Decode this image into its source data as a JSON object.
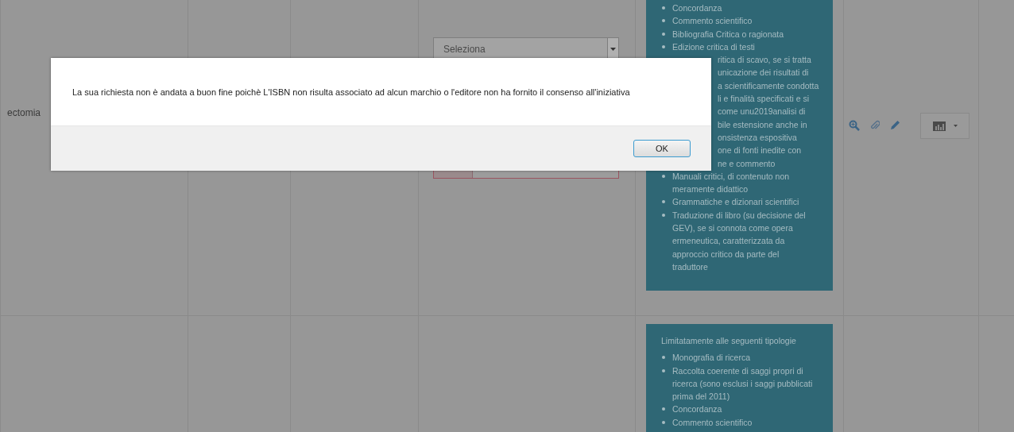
{
  "table": {
    "rows": [
      {
        "cells": [
          {
            "text": "ectomia"
          }
        ],
        "select": {
          "value": "Seleziona"
        },
        "invalid_input": true,
        "info_panel": {
          "items": [
            {
              "kind": "bullet",
              "text": "Concordanza"
            },
            {
              "kind": "bullet",
              "text": "Commento scientifico"
            },
            {
              "kind": "bullet",
              "text": "Bibliografia Critica o ragionata"
            },
            {
              "kind": "bullet",
              "text": "Edizione critica di testi"
            },
            {
              "kind": "fragment",
              "text": "ritica di scavo, se si tratta"
            },
            {
              "kind": "fragment",
              "text": "unicazione dei risultati di"
            },
            {
              "kind": "fragment",
              "text": "a scientificamente condotta"
            },
            {
              "kind": "fragment",
              "text": "li e finalità specificati e si"
            },
            {
              "kind": "fragment",
              "text": "come unu2019analisi di"
            },
            {
              "kind": "fragment",
              "text": "bile estensione anche in"
            },
            {
              "kind": "fragment",
              "text": "onsistenza espositiva"
            },
            {
              "kind": "fragment",
              "text": "one di fonti inedite con"
            },
            {
              "kind": "fragment",
              "text": "ne e commento"
            },
            {
              "kind": "bullet",
              "text": "Manuali critici, di contenuto non meramente didattico"
            },
            {
              "kind": "bullet",
              "text": "Grammatiche e dizionari scientifici"
            },
            {
              "kind": "bullet",
              "text": "Traduzione di libro (su decisione del GEV), se si connota come opera ermeneutica, caratterizzata da approccio critico da parte del traduttore"
            }
          ]
        }
      },
      {
        "cells": [],
        "info_panel": {
          "intro": "Limitatamente alle seguenti tipologie",
          "items": [
            {
              "kind": "bullet",
              "text": "Monografia di ricerca"
            },
            {
              "kind": "bullet",
              "text": "Raccolta coerente di saggi propri di ricerca (sono esclusi i saggi pubblicati prima del 2011)"
            },
            {
              "kind": "bullet",
              "text": "Concordanza"
            },
            {
              "kind": "bullet",
              "text": "Commento scientifico"
            }
          ]
        }
      }
    ]
  },
  "dialog": {
    "message": "La sua richiesta non è andata a buon fine poichè L'ISBN non risulta associato ad alcun marchio o l'editore non ha fornito il consenso all'iniziativa",
    "buttons": [
      "OK"
    ]
  }
}
